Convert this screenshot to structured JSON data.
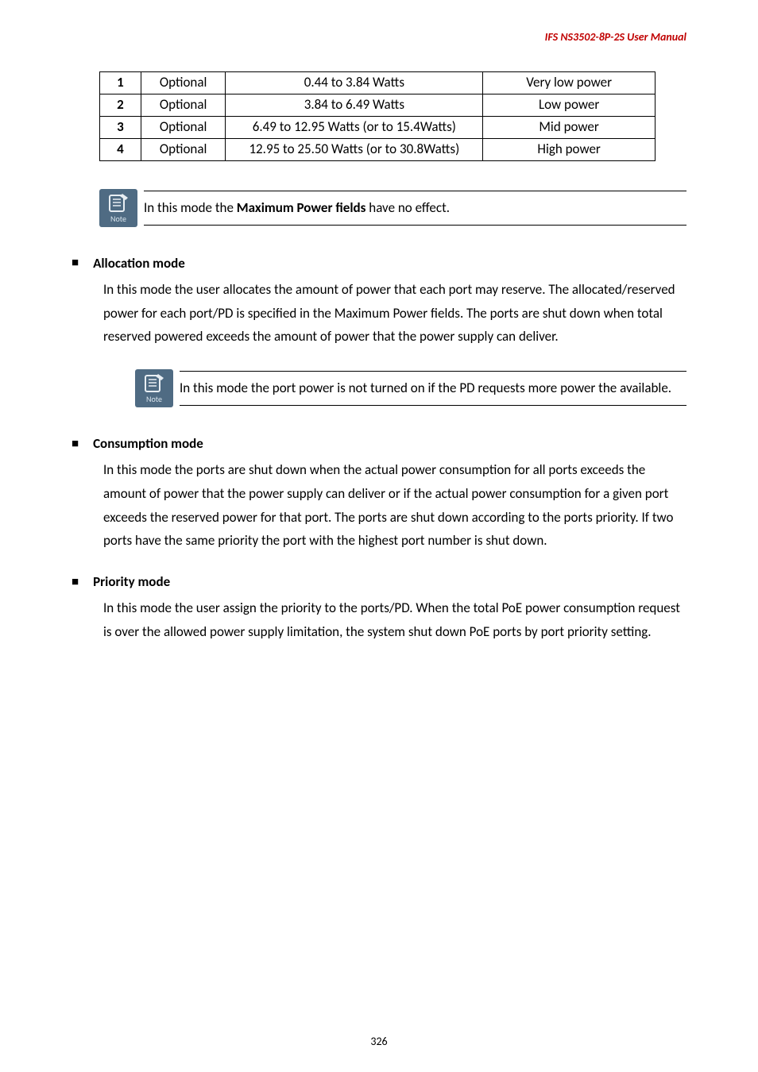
{
  "header": {
    "doc_title": "IFS  NS3502-8P-2S  User  Manual"
  },
  "power_table": {
    "rows": [
      {
        "idx": "1",
        "opt": "Optional",
        "range": "0.44 to 3.84 Watts",
        "desc": "Very low power"
      },
      {
        "idx": "2",
        "opt": "Optional",
        "range": "3.84 to 6.49 Watts",
        "desc": "Low power"
      },
      {
        "idx": "3",
        "opt": "Optional",
        "range": "6.49 to 12.95 Watts (or to 15.4Watts)",
        "desc": "Mid power"
      },
      {
        "idx": "4",
        "opt": "Optional",
        "range": "12.95 to 25.50 Watts (or to 30.8Watts)",
        "desc": "High power"
      }
    ]
  },
  "note1": {
    "prefix": "In this mode the ",
    "bold": "Maximum Power fields",
    "suffix": " have no effect."
  },
  "note_label": "Note",
  "sections": {
    "allocation": {
      "heading": "Allocation mode",
      "body": "In this mode the user allocates the amount of power that each port may reserve. The allocated/reserved power for each port/PD is specified in the Maximum Power fields. The ports are shut down when total reserved powered exceeds the amount of power that the power supply can deliver."
    },
    "allocation_note": "In this mode the port power is not turned on if the PD requests more power the available.",
    "consumption": {
      "heading": "Consumption mode",
      "body": "In this mode the ports are shut down when the actual power consumption for all ports exceeds the amount of power that the power supply can deliver or if the actual power consumption for a given port exceeds the reserved power for that port. The ports are shut down according to the ports priority. If two ports have the same priority the port with the highest port number is shut down."
    },
    "priority": {
      "heading": "Priority mode",
      "body": "In this mode the user assign the priority to the ports/PD. When the total PoE power consumption request is over the allowed power supply limitation, the system shut down PoE ports by port priority setting."
    }
  },
  "page_number": "326"
}
